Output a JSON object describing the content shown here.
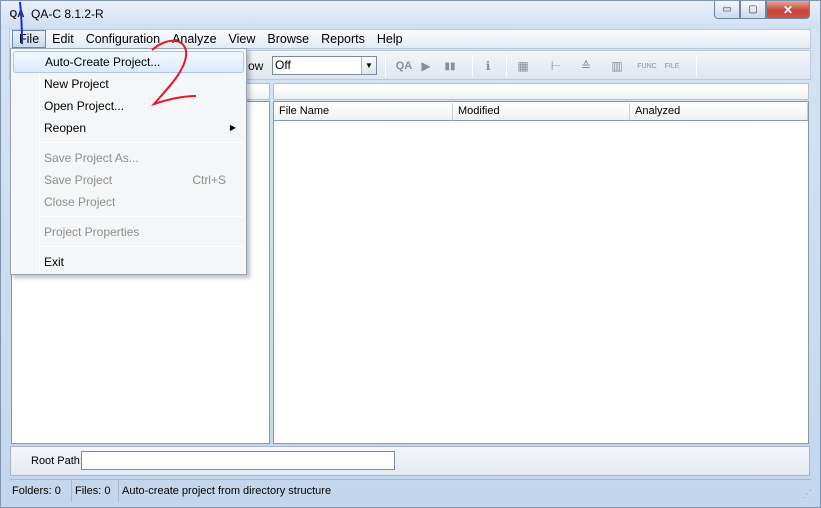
{
  "window": {
    "title": "QA-C 8.1.2-R",
    "app_icon": "QA",
    "controls": {
      "minimize": "▭",
      "maximize": "▢",
      "close": "✕"
    }
  },
  "menubar": [
    "File",
    "Edit",
    "Configuration",
    "Analyze",
    "View",
    "Browse",
    "Reports",
    "Help"
  ],
  "toolbar": {
    "label_fragment": "ow",
    "combo_value": "Off",
    "combo_arrow": "▼",
    "icons": [
      {
        "name": "qa-analyze-icon",
        "glyph": "QA"
      },
      {
        "name": "run-icon",
        "glyph": "▶"
      },
      {
        "name": "pause-icon",
        "glyph": "▮▮"
      },
      {
        "name": "info-icon",
        "glyph": "ℹ"
      },
      {
        "name": "grid-icon",
        "glyph": "▦"
      },
      {
        "name": "tree-icon",
        "glyph": "⊢"
      },
      {
        "name": "stack-icon",
        "glyph": "≙"
      },
      {
        "name": "bar-chart-icon",
        "glyph": "▥"
      },
      {
        "name": "func-icon",
        "glyph": "FUNC"
      },
      {
        "name": "file-icon",
        "glyph": "FILE"
      }
    ]
  },
  "file_list": {
    "columns": [
      "File Name",
      "Modified",
      "Analyzed"
    ]
  },
  "root_path": {
    "label": "Root Path:",
    "value": ""
  },
  "status": {
    "folders": "Folders:  0",
    "files": "Files:  0",
    "message": "Auto-create project from directory structure"
  },
  "file_menu": {
    "items": [
      {
        "label": "Auto-Create Project...",
        "enabled": true,
        "hover": true
      },
      {
        "label": "New Project",
        "enabled": true
      },
      {
        "label": "Open Project...",
        "enabled": true
      },
      {
        "label": "Reopen",
        "enabled": true,
        "submenu": "▶"
      },
      {
        "label": "Save Project As...",
        "enabled": false
      },
      {
        "label": "Save Project",
        "enabled": false,
        "shortcut": "Ctrl+S"
      },
      {
        "label": "Close Project",
        "enabled": false
      },
      {
        "label": "Project Properties",
        "enabled": false
      },
      {
        "label": "Exit",
        "enabled": true
      }
    ]
  },
  "annotation_color": "#e8182a",
  "annotation_blue": "#1a2ad8"
}
